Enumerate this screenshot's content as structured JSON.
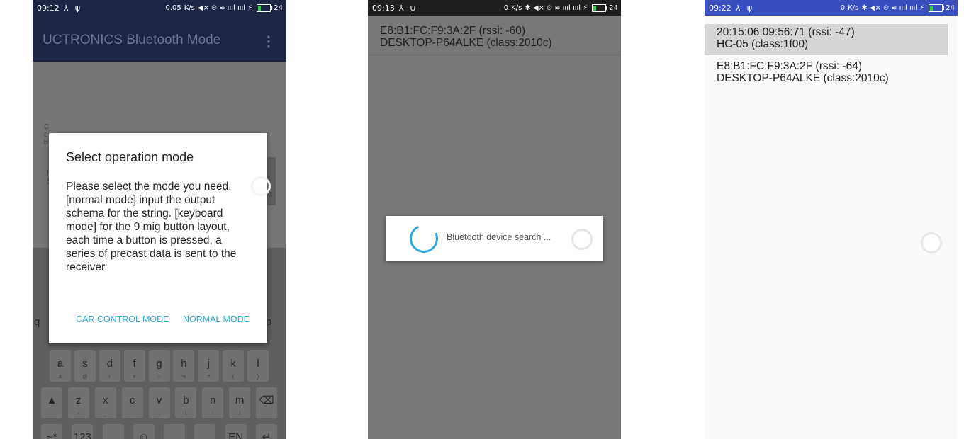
{
  "screens": {
    "one": {
      "status": {
        "time": "09:12",
        "left_icons": "⅄ ψ",
        "net": "0.05",
        "unit": "K/s",
        "icons": "◀× ⏲ ≋ ıııl ıııl ⚡",
        "battery": "24"
      },
      "app_title": "UCTRONICS Bluetooth Mode",
      "overflow_icon": "⋮",
      "background_hint": {
        "side_letters": "C\nc\nb",
        "left_field": "I\nS"
      },
      "dialog": {
        "title": "Select operation mode",
        "message": "Please select the mode you need.[normal mode] input the output schema for the string. [keyboard mode] for the 9 mig button layout, each time a button is pressed, a series of precast data is sent to the receiver.",
        "negative_button": "CAR CONTROL MODE",
        "positive_button": "NORMAL MODE"
      },
      "keyboard": {
        "edge_left": "q",
        "edge_right": "p",
        "row2": [
          {
            "k": "a",
            "s": "&"
          },
          {
            "k": "s",
            "s": "@"
          },
          {
            "k": "d",
            "s": "!"
          },
          {
            "k": "f",
            "s": "#"
          },
          {
            "k": "g",
            "s": "~"
          },
          {
            "k": "h",
            "s": "%"
          },
          {
            "k": "j",
            "s": "?"
          },
          {
            "k": "k",
            "s": "("
          },
          {
            "k": "l",
            "s": ")"
          }
        ],
        "row3": [
          {
            "k": "▲",
            "s": ""
          },
          {
            "k": "z",
            "s": "-"
          },
          {
            "k": "x",
            "s": "_"
          },
          {
            "k": "c",
            "s": ":"
          },
          {
            "k": "v",
            "s": ";"
          },
          {
            "k": "b",
            "s": "\\"
          },
          {
            "k": "n",
            "s": "'"
          },
          {
            "k": "m",
            "s": "/"
          },
          {
            "k": "⌫",
            "s": ""
          }
        ],
        "row4": [
          {
            "k": "~*",
            "s": ""
          },
          {
            "k": "123",
            "s": ""
          },
          {
            "k": ",",
            "s": ""
          },
          {
            "k": "☺",
            "s": ""
          },
          {
            "k": "",
            "s": ""
          },
          {
            "k": ".",
            "s": ""
          },
          {
            "k": "EN",
            "s": ""
          },
          {
            "k": "↵",
            "s": ""
          }
        ]
      }
    },
    "two": {
      "status": {
        "time": "09:13",
        "left_icons": "⅄ ψ",
        "net": "0",
        "unit": "K/s",
        "icons": "✱ ◀× ⏲ ≋ ıııl ıııl ⚡",
        "battery": "24"
      },
      "device": "E8:B1:FC:F9:3A:2F (rssi: -60)\nDESKTOP-P64ALKE (class:2010c)",
      "progress_message": "Bluetooth device search ..."
    },
    "three": {
      "status": {
        "time": "09:22",
        "left_icons": "⅄ ψ",
        "net": "0",
        "unit": "K/s",
        "icons": "✱ ◀× ⏲ ≋ ıııl ıııl ⚡",
        "battery": "24"
      },
      "devices": [
        "20:15:06:09:56:71 (rssi: -47)\nHC-05 (class:1f00)",
        "E8:B1:FC:F9:3A:2F (rssi: -64)\nDESKTOP-P64ALKE (class:2010c)"
      ]
    }
  },
  "colors": {
    "app_bar": "#1d2545",
    "dim_overlay": "#767676",
    "accent": "#29a9e0",
    "status_bar_blue": "#3850bf",
    "selected_row": "#d6d6d6"
  }
}
